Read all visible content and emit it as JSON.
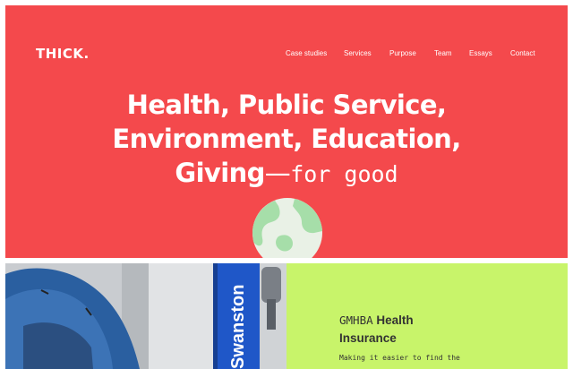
{
  "brand": {
    "logo": "THICK."
  },
  "nav": {
    "items": [
      {
        "label": "Case studies"
      },
      {
        "label": "Services"
      },
      {
        "label": "Purpose"
      },
      {
        "label": "Team"
      },
      {
        "label": "Essays"
      },
      {
        "label": "Contact"
      }
    ]
  },
  "hero": {
    "line1": "Health, Public Service,",
    "line2": "Environment, Education,",
    "line3_bold": "Giving",
    "line3_dash": "—",
    "line3_mono": "for good",
    "globe_icon": "globe-icon",
    "colors": {
      "background": "#f4494c",
      "globe_land": "#a6dea9",
      "globe_sea": "#e9f1e6"
    }
  },
  "feature": {
    "photo_sign_text": "Swanston",
    "title_prefix": "GMHBA",
    "title_bold_1": "Health",
    "title_bold_2": "Insurance",
    "text": "Making it easier to find the",
    "colors": {
      "card_background": "#c8f46a",
      "sign_blue": "#1f57c8"
    }
  }
}
